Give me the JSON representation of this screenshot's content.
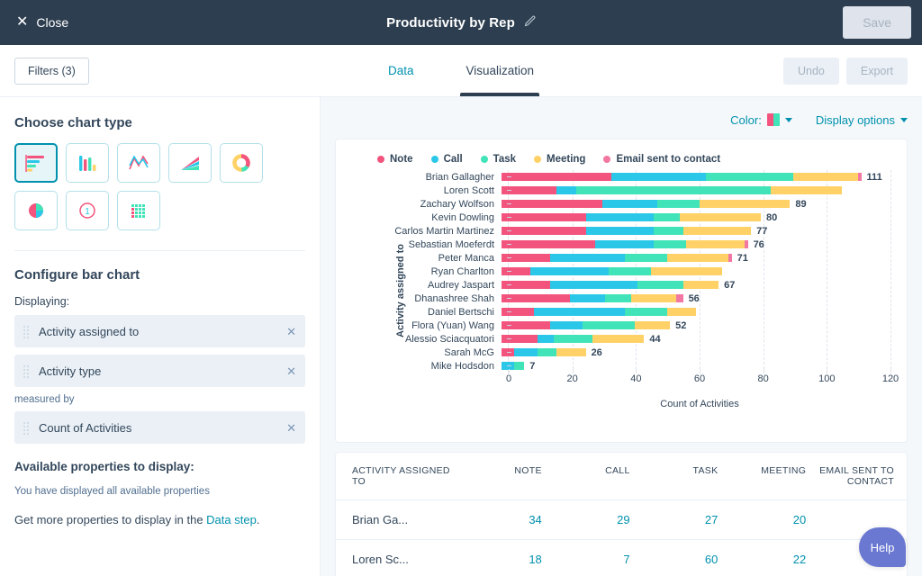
{
  "topbar": {
    "close_label": "Close",
    "title": "Productivity by Rep",
    "edit_icon": "pencil-icon",
    "save_label": "Save"
  },
  "subbar": {
    "filters_label": "Filters (3)",
    "tabs": [
      {
        "label": "Data",
        "active": false
      },
      {
        "label": "Visualization",
        "active": true
      }
    ],
    "undo_label": "Undo",
    "export_label": "Export"
  },
  "sidebar": {
    "chart_type_heading": "Choose chart type",
    "chart_types": [
      {
        "name": "horizontal-bar-chart-type",
        "selected": true
      },
      {
        "name": "vertical-bar-chart-type",
        "selected": false
      },
      {
        "name": "line-chart-type",
        "selected": false
      },
      {
        "name": "area-chart-type",
        "selected": false
      },
      {
        "name": "donut-chart-type",
        "selected": false
      },
      {
        "name": "pie-chart-type",
        "selected": false
      },
      {
        "name": "single-value-chart-type",
        "selected": false
      },
      {
        "name": "table-chart-type",
        "selected": false
      }
    ],
    "configure_heading": "Configure bar chart",
    "displaying_label": "Displaying:",
    "displaying_props": [
      "Activity assigned to",
      "Activity type"
    ],
    "measured_by_label": "measured by",
    "measure_prop": "Count of Activities",
    "available_heading": "Available properties to display:",
    "available_note": "You have displayed all available properties",
    "get_more_prefix": "Get more properties to display in the ",
    "get_more_link": "Data step",
    "get_more_suffix": "."
  },
  "content": {
    "color_label": "Color:",
    "display_options_label": "Display options",
    "color_swatch": [
      "#f2547d",
      "#41e3b8"
    ]
  },
  "chart_data": {
    "type": "bar",
    "orientation": "horizontal",
    "stacked": true,
    "title": "",
    "xlabel": "Count of Activities",
    "ylabel": "Activity assigned to",
    "xlim": [
      0,
      120
    ],
    "xticks": [
      0,
      20,
      40,
      60,
      80,
      100,
      120
    ],
    "grid": true,
    "legend_position": "top-left",
    "categories": [
      "Brian Gallagher",
      "Loren Scott",
      "Zachary Wolfson",
      "Kevin Dowling",
      "Carlos Martin Martinez",
      "Sebastian Moeferdt",
      "Peter Manca",
      "Ryan Charlton",
      "Audrey Jaspart",
      "Dhanashree Shah",
      "Daniel Bertschi",
      "Flora (Yuan) Wang",
      "Alessio Sciacquatori",
      "Sarah McG",
      "Mike Hodsdon"
    ],
    "series": [
      {
        "name": "Note",
        "color": "#f2547d",
        "values": [
          34,
          17,
          31,
          26,
          26,
          29,
          15,
          9,
          15,
          21,
          10,
          15,
          11,
          4,
          0
        ]
      },
      {
        "name": "Call",
        "color": "#2bc7e8",
        "values": [
          29,
          6,
          17,
          21,
          21,
          18,
          23,
          24,
          27,
          11,
          28,
          10,
          5,
          7,
          4
        ]
      },
      {
        "name": "Task",
        "color": "#41e3b8",
        "values": [
          27,
          60,
          13,
          8,
          9,
          10,
          13,
          13,
          14,
          8,
          13,
          16,
          12,
          6,
          3
        ]
      },
      {
        "name": "Meeting",
        "color": "#ffd166",
        "values": [
          20,
          22,
          28,
          25,
          21,
          18,
          19,
          22,
          11,
          14,
          9,
          11,
          16,
          9,
          0
        ]
      },
      {
        "name": "Email sent to contact",
        "color": "#f277a3",
        "values": [
          1,
          0,
          0,
          0,
          0,
          1,
          1,
          0,
          0,
          2,
          0,
          0,
          0,
          0,
          0
        ]
      }
    ],
    "totals": [
      111,
      105,
      89,
      80,
      77,
      76,
      71,
      68,
      67,
      56,
      60,
      52,
      44,
      26,
      7
    ],
    "total_labels": [
      "111",
      "",
      "89",
      "80",
      "77",
      "76",
      "71",
      "",
      "67",
      "56",
      "",
      "52",
      "44",
      "26",
      "7"
    ]
  },
  "table": {
    "columns": [
      "ACTIVITY ASSIGNED TO",
      "NOTE",
      "CALL",
      "TASK",
      "MEETING",
      "EMAIL SENT TO CONTACT"
    ],
    "rows": [
      {
        "name": "Brian Ga...",
        "values": [
          "34",
          "29",
          "27",
          "20",
          ""
        ]
      },
      {
        "name": "Loren Sc...",
        "values": [
          "18",
          "7",
          "60",
          "22",
          ""
        ]
      }
    ]
  },
  "help": {
    "label": "Help"
  }
}
